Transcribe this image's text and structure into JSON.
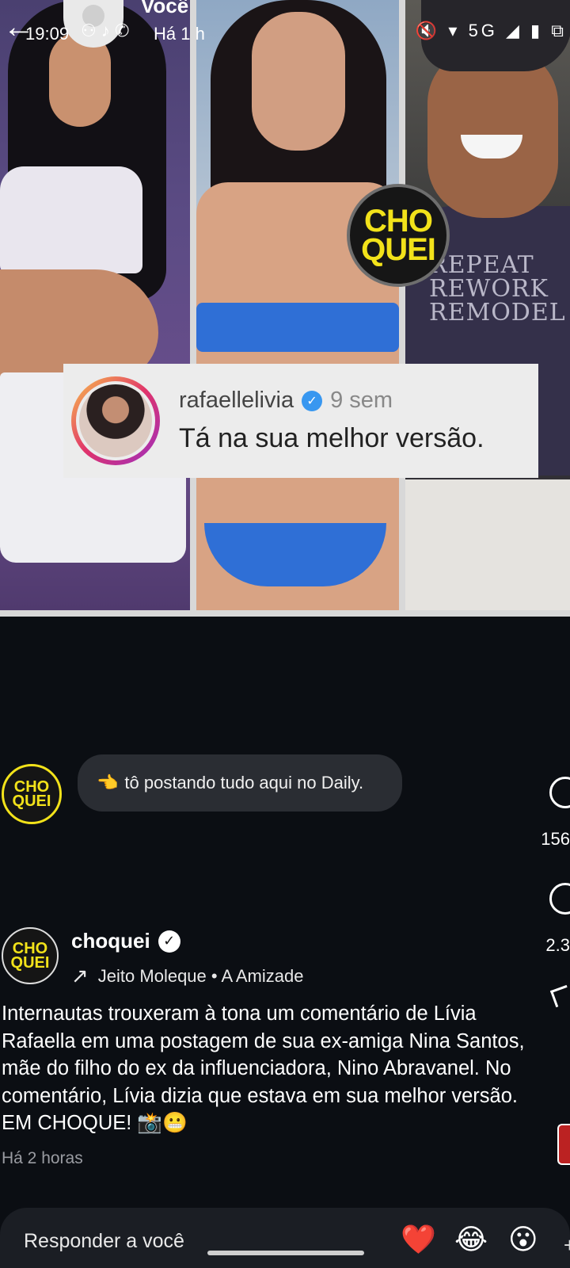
{
  "status_bar": {
    "time": "19:09",
    "icons": "⚇ ♪ ✆",
    "system": "🔇 ▾ 5G ◢ ▮ ⧉"
  },
  "story": {
    "owner": "Você",
    "age": "Há 1 h",
    "back_icon": "back-arrow-icon"
  },
  "media": {
    "badge_line1": "CHO",
    "badge_line2": "QUEI",
    "shirt_text": "REPEAT REWORK REMODEL",
    "comment": {
      "username": "rafaellelivia",
      "time": "9 sem",
      "text": "Tá na sua melhor versão."
    }
  },
  "note": {
    "logo_line1": "CHO",
    "logo_line2": "QUEI",
    "emoji": "👈",
    "text": "tô postando tudo aqui no Daily."
  },
  "actions": {
    "likes": "156",
    "comments": "2.3"
  },
  "post": {
    "logo_line1": "CHO",
    "logo_line2": "QUEI",
    "username": "choquei",
    "music": "Jeito Moleque • A Amizade",
    "caption": "Internautas trouxeram à tona um comentário de Lívia Rafaella em uma postagem de sua ex-amiga Nina Santos, mãe do filho do ex da influenciadora, Nino Abravanel. No comentário, Lívia dizia que estava em sua melhor versão. EM CHOQUE! 📸😬",
    "time": "Há 2 horas"
  },
  "reply": {
    "placeholder": "Responder a você",
    "reactions": [
      "❤️",
      "😂",
      "😮"
    ],
    "more": "+"
  }
}
